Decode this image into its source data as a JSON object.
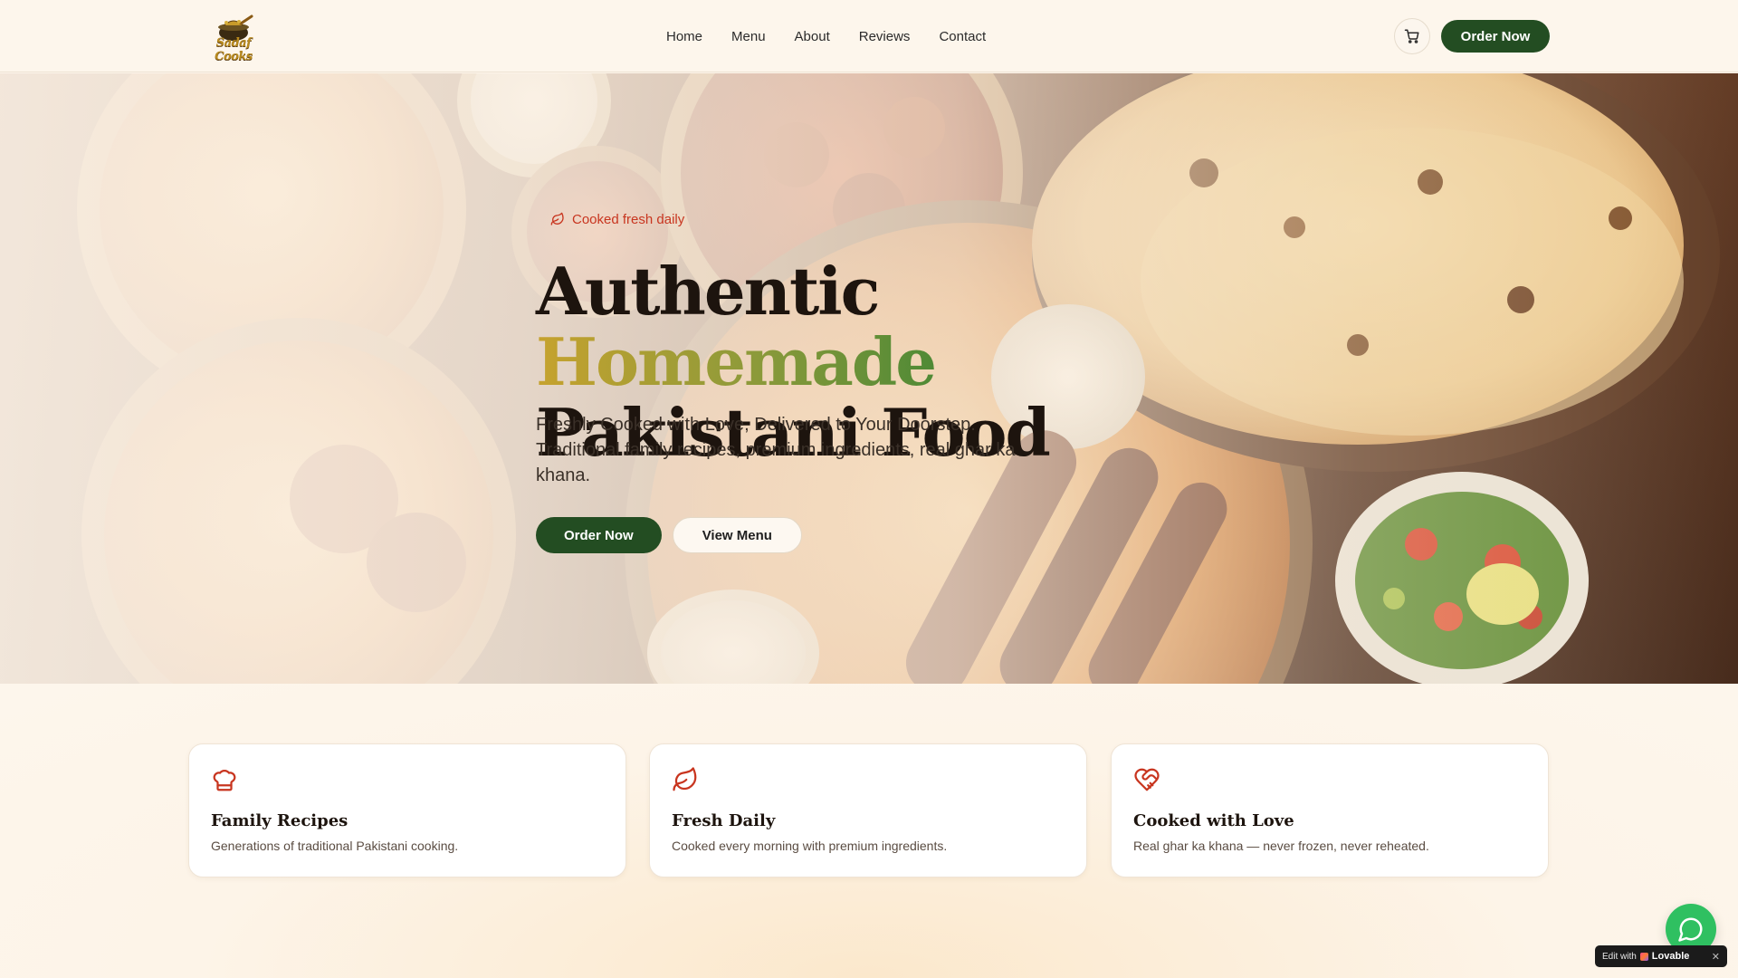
{
  "header": {
    "logo_text": "Sadaf Cooks",
    "nav": [
      {
        "label": "Home"
      },
      {
        "label": "Menu"
      },
      {
        "label": "About"
      },
      {
        "label": "Reviews"
      },
      {
        "label": "Contact"
      }
    ],
    "cart_icon": "shopping-cart-icon",
    "order_button": "Order Now"
  },
  "hero": {
    "badge_icon": "leaf-icon",
    "badge_text": "Cooked fresh daily",
    "title_part1": "Authentic ",
    "title_accent": "Homemade",
    "title_part2": "Pakistani Food",
    "subtitle_line1": "Freshly Cooked with Love, Delivered to Your Doorstep.",
    "subtitle_line2": "Traditional family recipes, premium ingredients, real ghar ka khana.",
    "primary_button": "Order Now",
    "secondary_button": "View Menu"
  },
  "features": [
    {
      "icon": "chef-hat-icon",
      "title": "Family Recipes",
      "description": "Generations of traditional Pakistani cooking."
    },
    {
      "icon": "leaf-icon",
      "title": "Fresh Daily",
      "description": "Cooked every morning with premium ingredients."
    },
    {
      "icon": "heart-handshake-icon",
      "title": "Cooked with Love",
      "description": "Real ghar ka khana — never frozen, never reheated."
    }
  ],
  "floating": {
    "chat_icon": "whatsapp-chat-icon",
    "badge_prefix": "Edit with",
    "badge_brand": "Lovable",
    "badge_close": "✕"
  },
  "colors": {
    "primary_green": "#234d22",
    "accent_red": "#c8351f",
    "background_cream": "#fdf6ec",
    "chat_green": "#2fc061"
  }
}
